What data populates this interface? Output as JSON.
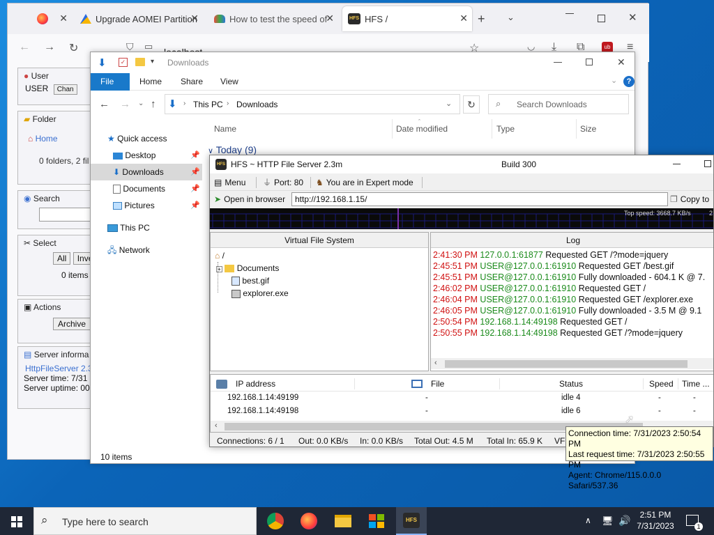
{
  "browser": {
    "tabs": [
      {
        "label": ""
      },
      {
        "label": "Upgrade AOMEI Partition"
      },
      {
        "label": "How to test the speed of"
      },
      {
        "label": "HFS /"
      }
    ],
    "url": "localhost"
  },
  "webpage": {
    "user_header": "User",
    "user_name": "USER",
    "change_button": "Chan",
    "folder_header": "Folder",
    "home_link": "Home",
    "folder_info": "0 folders, 2 fil",
    "search_header": "Search",
    "select_header": "Select",
    "all_button": "All",
    "invert_button": "Inve",
    "items_count": "0 items",
    "actions_header": "Actions",
    "archive_button": "Archive",
    "server_header": "Server informa",
    "server_link": "HttpFileServer 2.3",
    "server_time": "Server time: 7/31",
    "server_uptime": "Server uptime: 00"
  },
  "explorer": {
    "title": "Downloads",
    "ribbon_tabs": [
      "File",
      "Home",
      "Share",
      "View"
    ],
    "path": [
      "This PC",
      "Downloads"
    ],
    "search_placeholder": "Search Downloads",
    "nav": [
      {
        "label": "Quick access"
      },
      {
        "label": "Desktop"
      },
      {
        "label": "Downloads"
      },
      {
        "label": "Documents"
      },
      {
        "label": "Pictures"
      },
      {
        "label": "This PC"
      },
      {
        "label": "Network"
      }
    ],
    "columns": [
      "Name",
      "Date modified",
      "Type",
      "Size"
    ],
    "group": "Today (9)",
    "item_count": "10 items"
  },
  "hfs": {
    "title": "HFS ~ HTTP File Server 2.3m",
    "build": "Build 300",
    "menu": "Menu",
    "port": "Port: 80",
    "mode": "You are in Expert mode",
    "open_browser": "Open in browser",
    "url": "http://192.168.1.15/",
    "copy": "Copy to",
    "top_speed": "Top speed: 3668.7 KB/s",
    "top_speed_cut": "2",
    "vfs_header": "Virtual File System",
    "vfs_root": "/",
    "vfs_items": [
      "Documents",
      "best.gif",
      "explorer.exe"
    ],
    "log_header": "Log",
    "log": [
      {
        "time": "2:41:30 PM",
        "addr": "127.0.0.1:61877",
        "msg": "Requested GET /?mode=jquery"
      },
      {
        "time": "2:45:51 PM",
        "addr": "USER@127.0.0.1:61910",
        "msg": "Requested GET /best.gif"
      },
      {
        "time": "2:45:51 PM",
        "addr": "USER@127.0.0.1:61910",
        "msg": "Fully downloaded - 604.1 K @ 7."
      },
      {
        "time": "2:46:02 PM",
        "addr": "USER@127.0.0.1:61910",
        "msg": "Requested GET /"
      },
      {
        "time": "2:46:04 PM",
        "addr": "USER@127.0.0.1:61910",
        "msg": "Requested GET /explorer.exe"
      },
      {
        "time": "2:46:05 PM",
        "addr": "USER@127.0.0.1:61910",
        "msg": "Fully downloaded - 3.5 M @ 9.1"
      },
      {
        "time": "2:50:54 PM",
        "addr": "192.168.1.14:49198",
        "msg": "Requested GET /"
      },
      {
        "time": "2:50:55 PM",
        "addr": "192.168.1.14:49198",
        "msg": "Requested GET /?mode=jquery"
      }
    ],
    "conn_columns": [
      "IP address",
      "File",
      "Status",
      "Speed",
      "Time ..."
    ],
    "connections": [
      {
        "ip": "192.168.1.14:49199",
        "file": "-",
        "status": "idle 4",
        "speed": "-",
        "time": "-"
      },
      {
        "ip": "192.168.1.14:49198",
        "file": "-",
        "status": "idle 6",
        "speed": "-",
        "time": "-"
      }
    ],
    "status": {
      "connections": "Connections: 6 / 1",
      "out": "Out: 0.0 KB/s",
      "in": "In: 0.0 KB/s",
      "total_out": "Total Out: 4.5 M",
      "total_in": "Total In: 65.9 K",
      "vfs": "VFS"
    }
  },
  "tooltip": {
    "connection_time": "Connection time: 7/31/2023 2:50:54 PM",
    "last_request": "Last request time: 7/31/2023 2:50:55 PM",
    "agent": "Agent: Chrome/115.0.0.0 Safari/537.36"
  },
  "taskbar": {
    "search_placeholder": "Type here to search",
    "time": "2:51 PM",
    "date": "7/31/2023",
    "notification_count": "1"
  }
}
